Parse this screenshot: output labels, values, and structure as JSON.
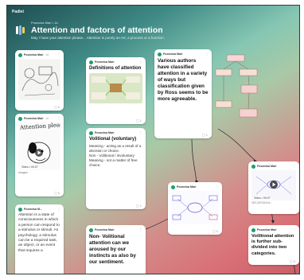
{
  "brand": "Padlet",
  "wall": {
    "author_line": "Poonvisa Mari • 1d",
    "title": "Attention and factors of attention",
    "description": "May I have your attention please... Attention is purely an Art, a process or a function."
  },
  "posts": [
    {
      "author": "Poonvisa Mari",
      "time": "1d",
      "comments": "0"
    },
    {
      "author": "Poonvisa Mari",
      "time": "1d",
      "title": "Attention please",
      "video_label": "Video • 00:07",
      "caption": "Images",
      "comments": "0"
    },
    {
      "author": "Poonvisa M...",
      "body": "Attention is a state of consciousness in which a person can respond to a stimulus or stimuli. As psychology, a stimulus can be a required task, an object, or an event that requires a"
    },
    {
      "author": "Poonvisa Mari",
      "title": "Definitions of attention",
      "comments": "1"
    },
    {
      "author": "Poonvisa Mari",
      "title": "Volitional (voluntary)",
      "body": "Meaning - acting as a result of a decision or choice.\nNon - Volitional / involuntary\nMeaning - not a matter of free choice.",
      "comments": "1"
    },
    {
      "author": "Poonvisa Mari",
      "title": "Non- Volitional attention can we aroused by our instincts as also by our sentiment.",
      "comments": "0"
    },
    {
      "author": "Poonvisa Mari",
      "title": "Various authors have classified attention in a variety of ways but classification given by Ross seems to be more agreeable.",
      "comments": "1"
    },
    {
      "author": "Poonvisa Mari",
      "comments": "0"
    },
    {
      "author": "Poonvisa Mari",
      "video_label": "Video • 00:07",
      "caption": "VID-20210414...",
      "comments": ""
    },
    {
      "author": "Poonvisa Mari",
      "title": "Voilitional attention is further sub-divided into two categories.",
      "comments": "0"
    }
  ],
  "icons": {
    "wall": "padlet-wall-icon",
    "avatar": "avatar-icon",
    "more": "more-dots-icon",
    "comment": "comment-icon",
    "play": "play-icon"
  },
  "colors": {
    "accent": "#1e9e6b",
    "connector": "#222222"
  }
}
